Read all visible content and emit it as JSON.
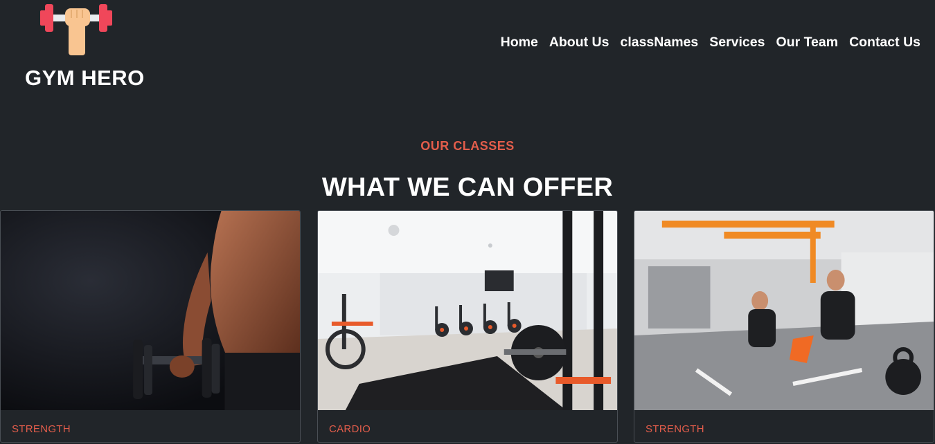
{
  "brand": {
    "name": "GYM HERO"
  },
  "nav": {
    "items": [
      {
        "label": "Home"
      },
      {
        "label": "About Us"
      },
      {
        "label": "classNames"
      },
      {
        "label": "Services"
      },
      {
        "label": "Our Team"
      },
      {
        "label": "Contact Us"
      }
    ]
  },
  "section": {
    "eyebrow": "OUR CLASSES",
    "title": "WHAT WE CAN OFFER"
  },
  "cards": [
    {
      "label": "STRENGTH"
    },
    {
      "label": "CARDIO"
    },
    {
      "label": "STRENGTH"
    }
  ],
  "icons": {
    "logo": "dumbbell-fist-icon"
  },
  "colors": {
    "background": "#212529",
    "text": "#ffffff",
    "accent": "#e35d4b",
    "dumbbell": "#f0475a",
    "fist": "#f9c591"
  }
}
